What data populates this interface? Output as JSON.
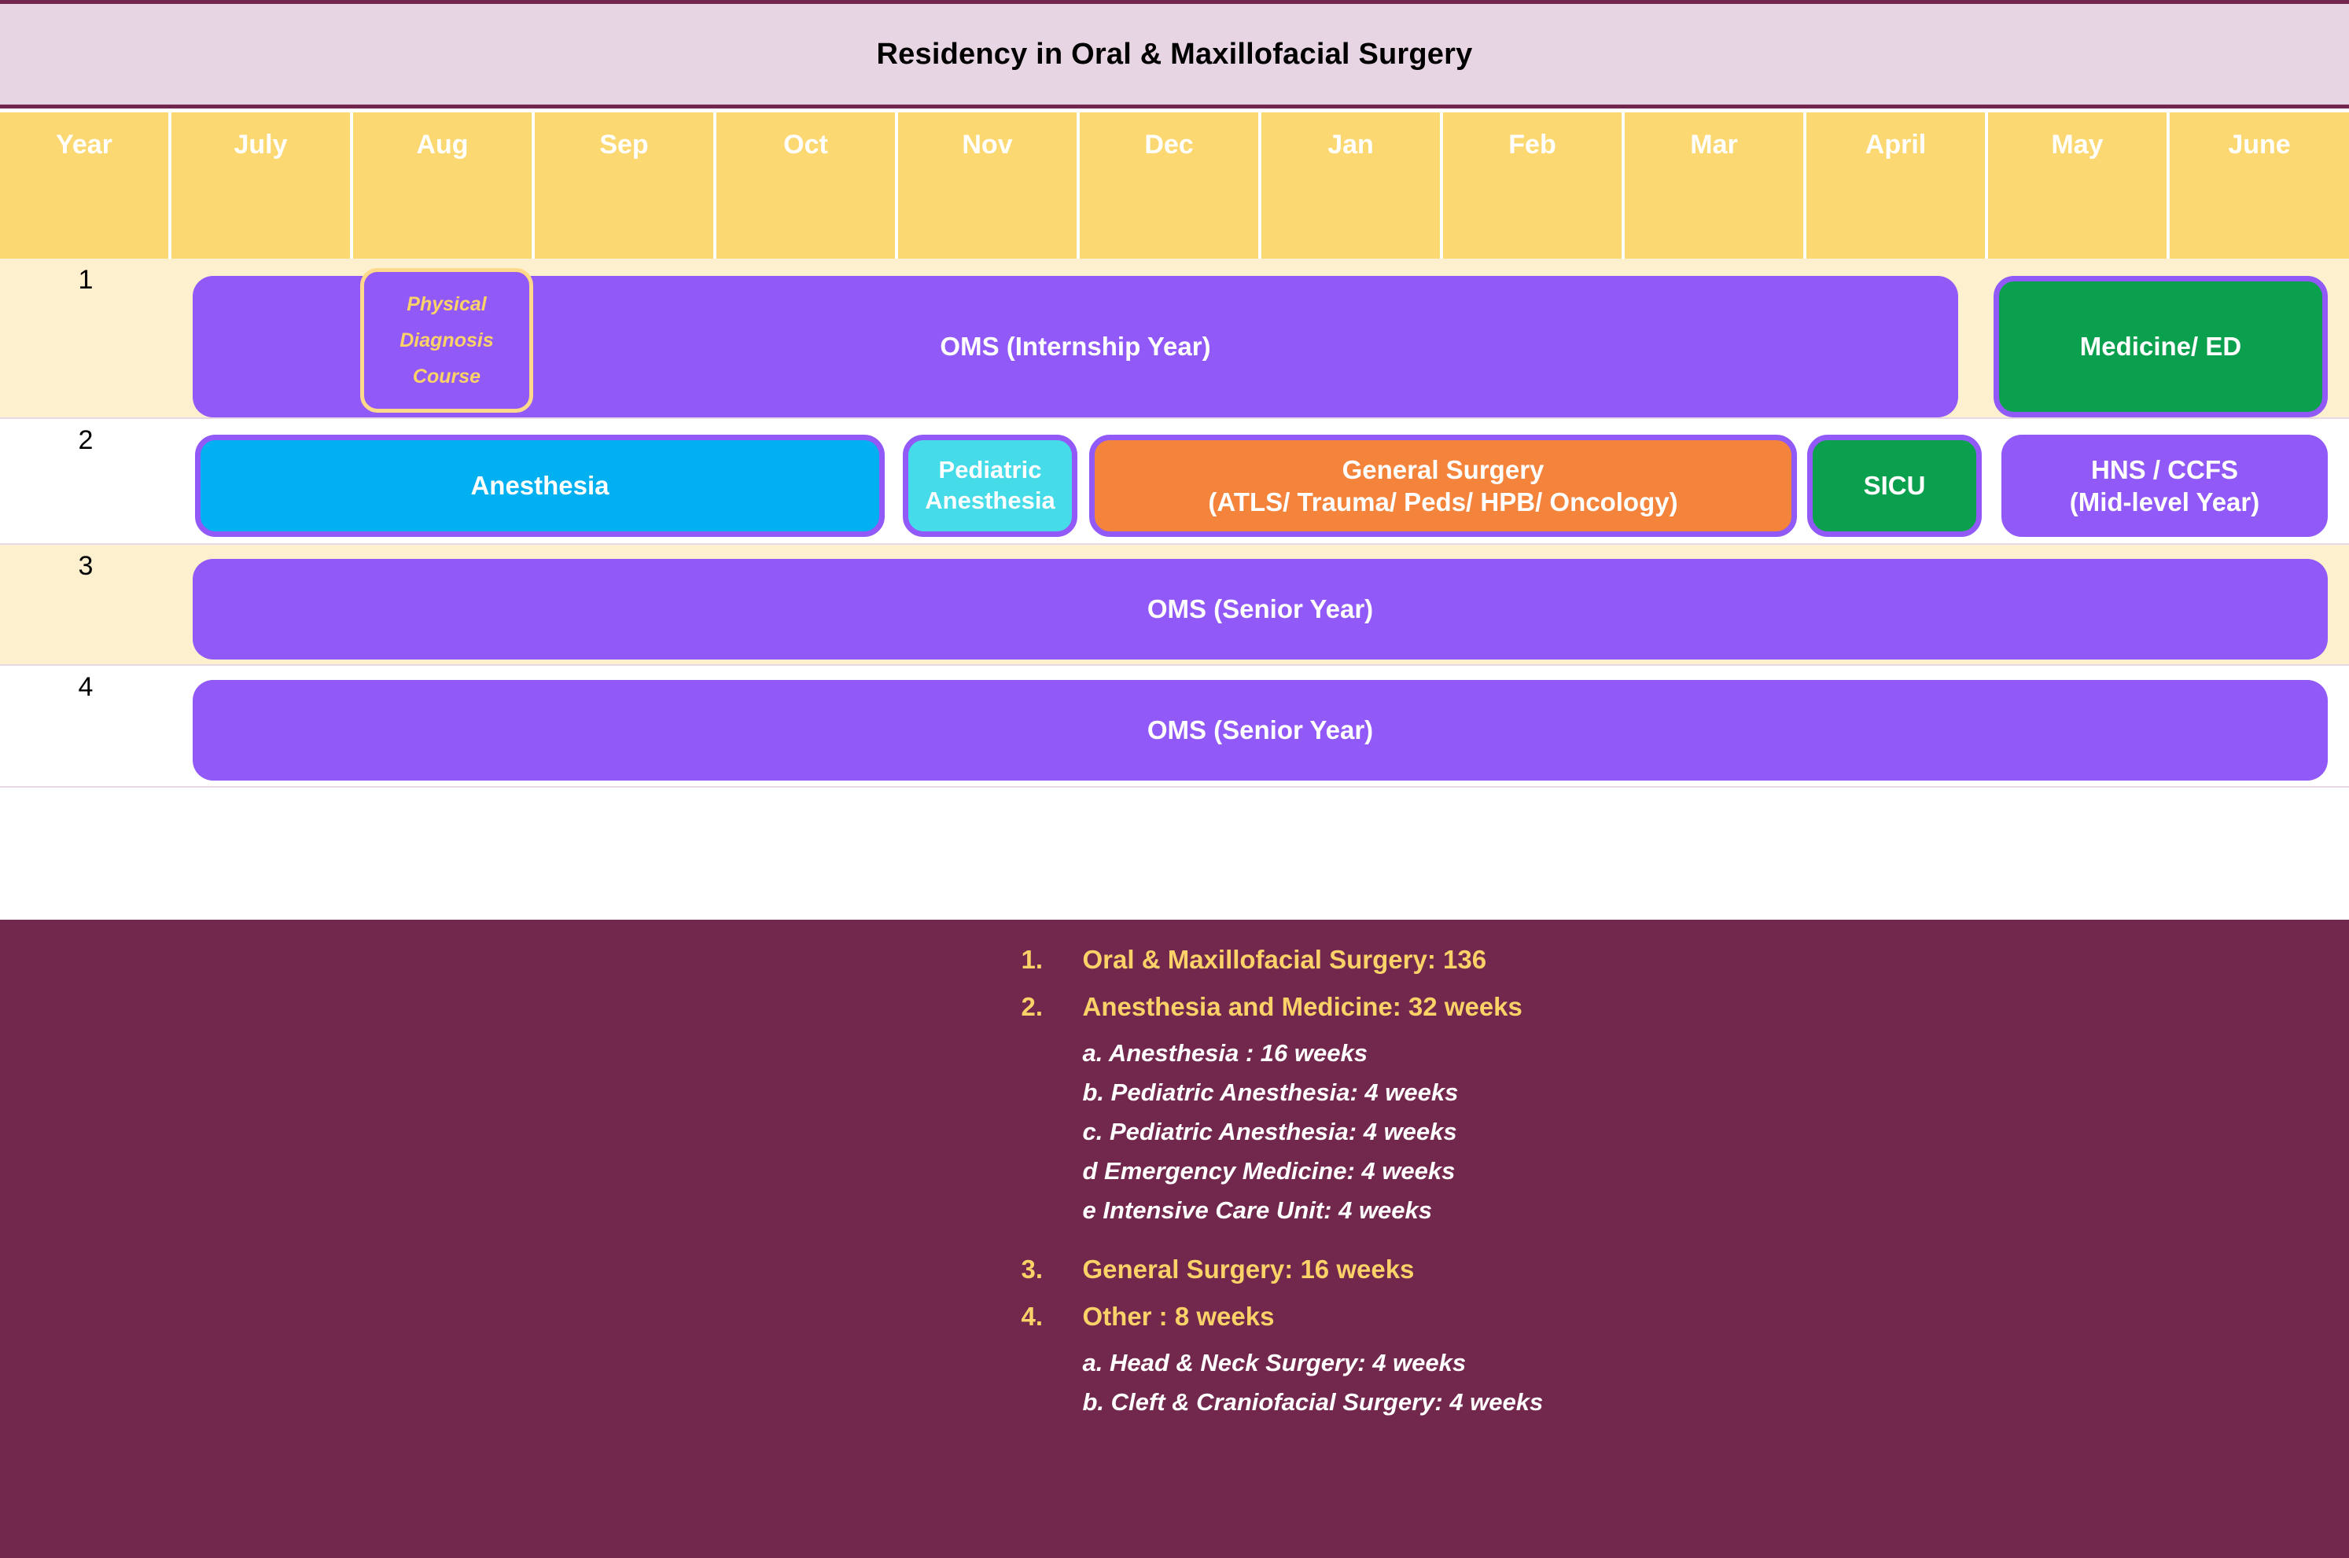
{
  "title": "Residency in Oral & Maxillofacial Surgery",
  "columns": [
    {
      "label": "Year"
    },
    {
      "label": "July"
    },
    {
      "label": "Aug"
    },
    {
      "label": "Sep"
    },
    {
      "label": "Oct"
    },
    {
      "label": "Nov"
    },
    {
      "label": "Dec"
    },
    {
      "label": "Jan"
    },
    {
      "label": "Feb"
    },
    {
      "label": "Mar"
    },
    {
      "label": "April"
    },
    {
      "label": "May"
    },
    {
      "label": "June"
    }
  ],
  "rows": [
    {
      "year": "1",
      "blocks": [
        {
          "label": "OMS (Internship Year)",
          "label2": "",
          "color": "#9159f7"
        },
        {
          "label": "Medicine/ ED",
          "label2": "",
          "color": "#0ba04d"
        }
      ],
      "callout": {
        "line1": "Physical",
        "line2": "Diagnosis",
        "line3": "Course"
      }
    },
    {
      "year": "2",
      "blocks": [
        {
          "label": "Anesthesia",
          "label2": "",
          "color": "#00b0f0"
        },
        {
          "label": "Pediatric",
          "label2": "Anesthesia",
          "color": "#45dbe8"
        },
        {
          "label": "General Surgery",
          "label2": "(ATLS/ Trauma/ Peds/ HPB/ Oncology)",
          "color": "#f4843c"
        },
        {
          "label": "SICU",
          "label2": "",
          "color": "#0ba04d"
        },
        {
          "label": "HNS / CCFS",
          "label2": "(Mid-level Year)",
          "color": "#9159f7"
        }
      ]
    },
    {
      "year": "3",
      "blocks": [
        {
          "label": "OMS (Senior Year)",
          "label2": "",
          "color": "#9159f7"
        }
      ]
    },
    {
      "year": "4",
      "blocks": [
        {
          "label": "OMS (Senior Year)",
          "label2": "",
          "color": "#9159f7"
        }
      ]
    }
  ],
  "footer": {
    "items": [
      {
        "num": "1.",
        "text": "Oral & Maxillofacial Surgery: 136",
        "subs": []
      },
      {
        "num": "2.",
        "text": "Anesthesia and Medicine: 32 weeks",
        "subs": [
          "a. Anesthesia : 16 weeks",
          "b. Pediatric Anesthesia:  4 weeks",
          "c. Pediatric Anesthesia:  4 weeks",
          "d Emergency Medicine: 4 weeks",
          "e Intensive Care Unit: 4 weeks"
        ]
      },
      {
        "num": "3.",
        "text": "General Surgery: 16 weeks",
        "subs": []
      },
      {
        "num": "4.",
        "text": "Other : 8 weeks",
        "subs": [
          "a. Head & Neck Surgery: 4 weeks",
          "b. Cleft & Craniofacial Surgery: 4 weeks"
        ]
      }
    ]
  },
  "colors": {
    "title_bar_bg": "#e8d5e4",
    "title_bar_border": "#73274f",
    "month_header_bg": "#fbd872",
    "row_alt_bg": "#fdf0cf",
    "footer_bg": "#72274d",
    "footer_accent": "#fbd268",
    "purple": "#9159f7",
    "green": "#0ba04d",
    "blue": "#00b0f0",
    "cyan": "#45dbe8",
    "orange": "#f4843c"
  }
}
